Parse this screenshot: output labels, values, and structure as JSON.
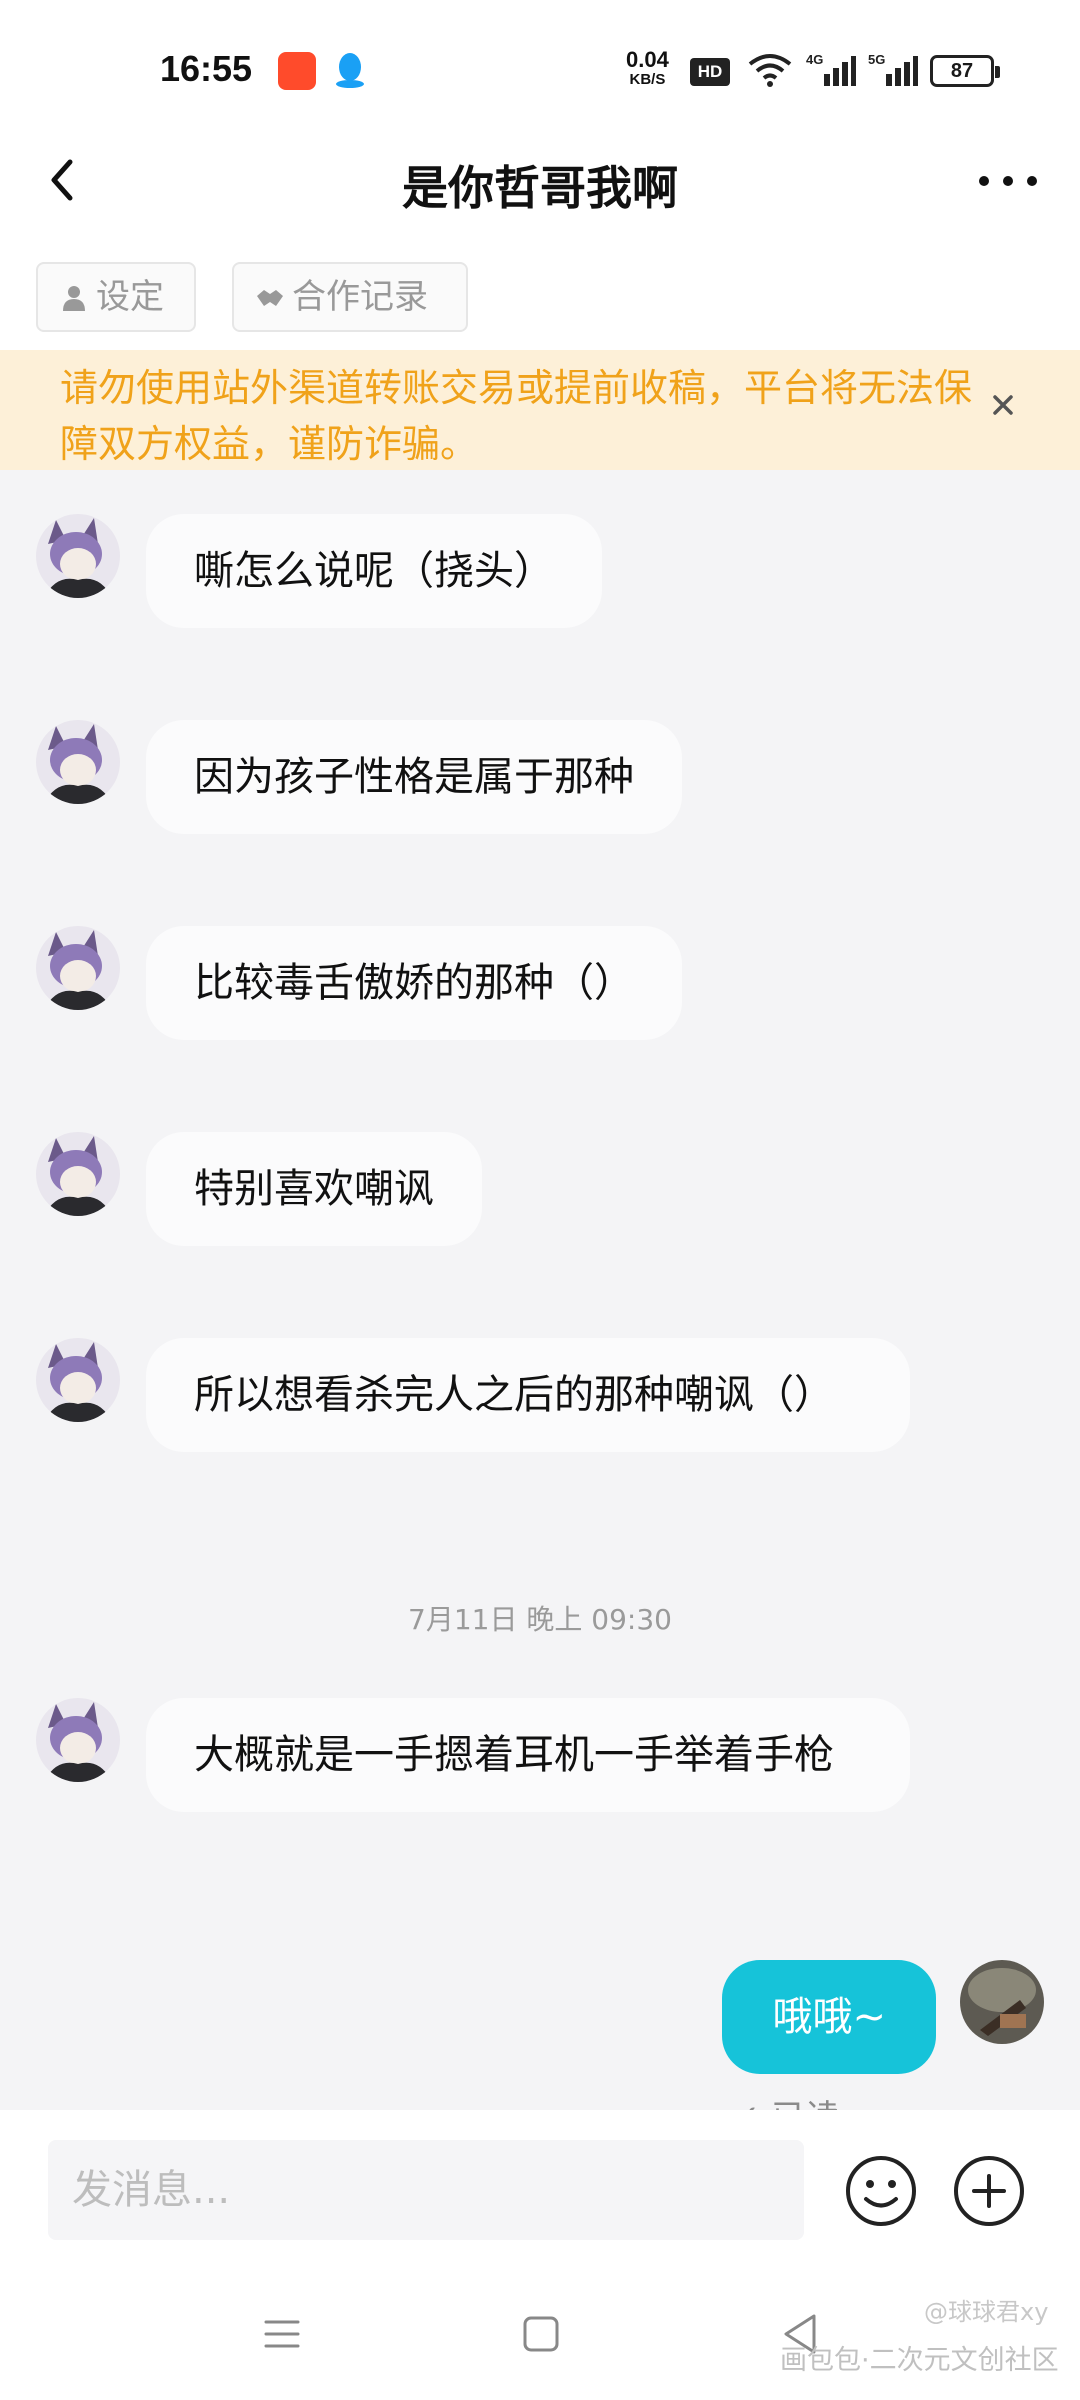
{
  "status_bar": {
    "time": "16:55",
    "net_speed": "0.04",
    "net_unit": "KB/S",
    "hd_label": "HD",
    "signal1_label": "4G",
    "signal2_label": "5G",
    "battery": "87"
  },
  "header": {
    "title": "是你哲哥我啊"
  },
  "tags": {
    "setting": "设定",
    "cooperation": "合作记录"
  },
  "warning": {
    "text": "请勿使用站外渠道转账交易或提前收稿，平台将无法保障双方权益，谨防诈骗。"
  },
  "messages": [
    {
      "from": "other",
      "text": "嘶怎么说呢（挠头）"
    },
    {
      "from": "other",
      "text": "因为孩子性格是属于那种"
    },
    {
      "from": "other",
      "text": "比较毒舌傲娇的那种（）"
    },
    {
      "from": "other",
      "text": "特别喜欢嘲讽"
    },
    {
      "from": "other",
      "text": "所以想看杀完人之后的那种嘲讽（）"
    },
    {
      "from": "other",
      "text": "大概就是一手摁着耳机一手举着手枪"
    },
    {
      "from": "me",
      "text": "哦哦~"
    }
  ],
  "timestamp": "7月11日 晚上 09:30",
  "read_status": "✓ 已读",
  "input": {
    "placeholder": "发消息..."
  },
  "watermark": {
    "line1": "@球球君xy",
    "line2": "画包包·二次元文创社区"
  },
  "colors": {
    "accent": "#16c3d9",
    "warning_bg": "#fdf0d8",
    "warning_text": "#f0a21a",
    "chat_bg": "#f4f4f6"
  }
}
